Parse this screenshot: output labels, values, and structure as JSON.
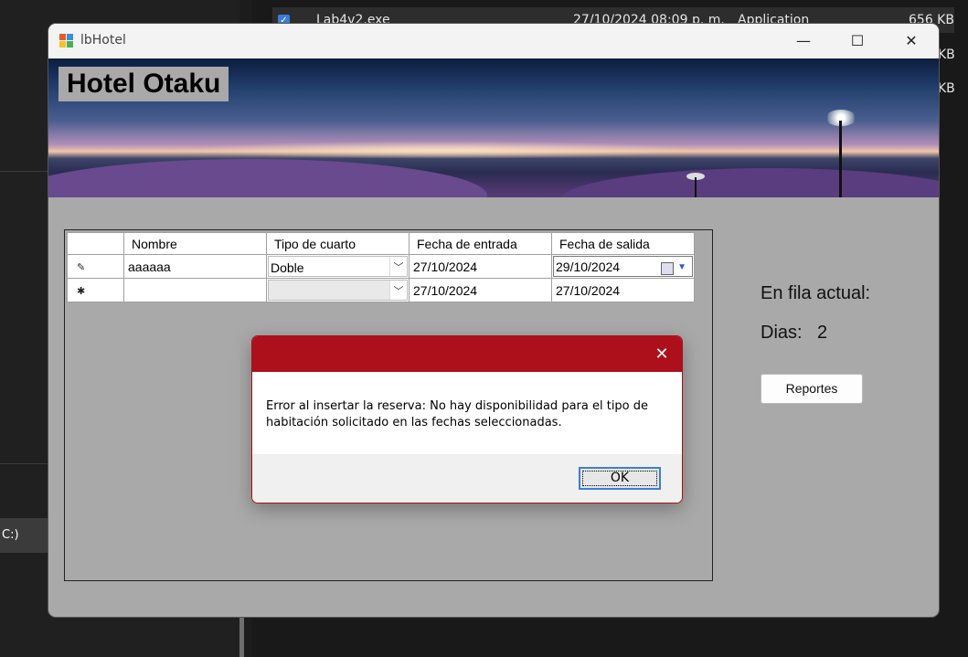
{
  "background": {
    "file_row": {
      "name": "Lab4v2.exe",
      "date": "27/10/2024 08:09 p. m.",
      "type": "Application",
      "size": "656 KB"
    },
    "size_fragments": [
      "KB",
      "KB"
    ],
    "drive_label": "C:)"
  },
  "window": {
    "title": "lbHotel",
    "minimize": "—",
    "maximize": "☐",
    "close": "✕"
  },
  "banner": {
    "title": "Hotel Otaku"
  },
  "grid": {
    "columns": [
      "Nombre",
      "Tipo de cuarto",
      "Fecha de entrada",
      "Fecha de salida"
    ],
    "rows": [
      {
        "indicator": "✎",
        "nombre": "aaaaaa",
        "tipo": "Doble",
        "entrada": "27/10/2024",
        "salida": "29/10/2024"
      },
      {
        "indicator": "✱",
        "nombre": "",
        "tipo": "",
        "entrada": "27/10/2024",
        "salida": "27/10/2024"
      }
    ]
  },
  "side": {
    "fila_label": "En fila actual:",
    "dias_label": "Dias:",
    "dias_value": "2",
    "reportes_button": "Reportes"
  },
  "dialog": {
    "close": "✕",
    "message": "Error al insertar la reserva: No hay disponibilidad para el tipo de habitación solicitado en las fechas seleccionadas.",
    "ok_button": "OK"
  },
  "colors": {
    "dialog_header": "#ad0f1b",
    "form_background": "#a9a9a9",
    "ok_focus": "#3c7fd6"
  }
}
